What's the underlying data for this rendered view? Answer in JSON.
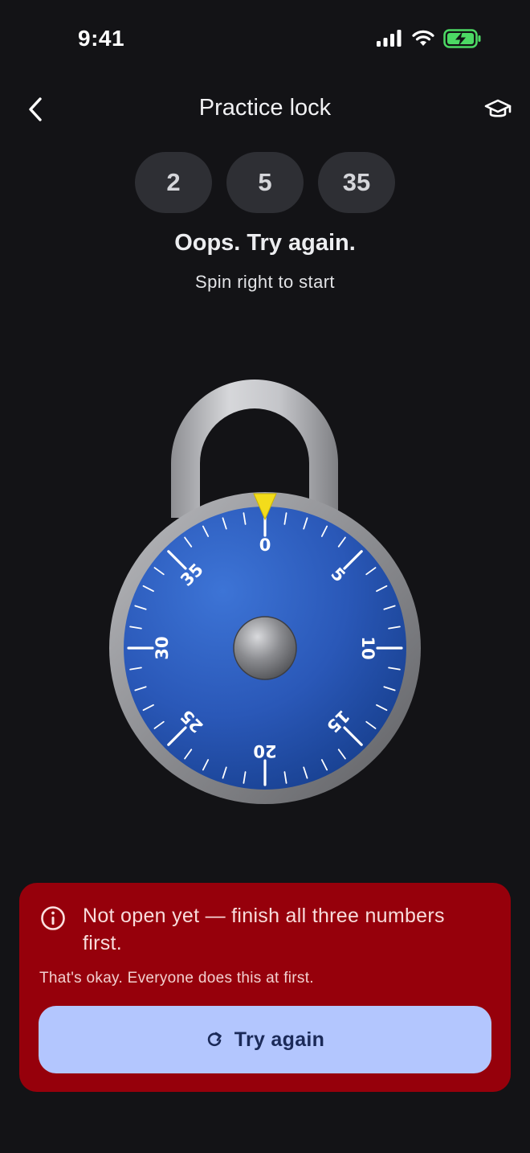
{
  "status_bar": {
    "time": "9:41"
  },
  "header": {
    "title": "Practice lock"
  },
  "combination": [
    "2",
    "5",
    "35"
  ],
  "feedback": {
    "heading": "Oops. Try again.",
    "hint": "Spin right to start"
  },
  "dial": {
    "labels": [
      "0",
      "5",
      "10",
      "15",
      "20",
      "25",
      "30",
      "35"
    ],
    "pointer_position": 0,
    "max_value": 40,
    "face_color": "#2f5fbe",
    "pointer_color": "#f3dc1b"
  },
  "alert": {
    "message": "Not open yet — finish all three numbers first.",
    "reassurance": "That's okay. Everyone does this at first.",
    "button_label": "Try again"
  },
  "colors": {
    "background": "#131316",
    "alert": "#96000b",
    "button": "#b3c6fe"
  }
}
